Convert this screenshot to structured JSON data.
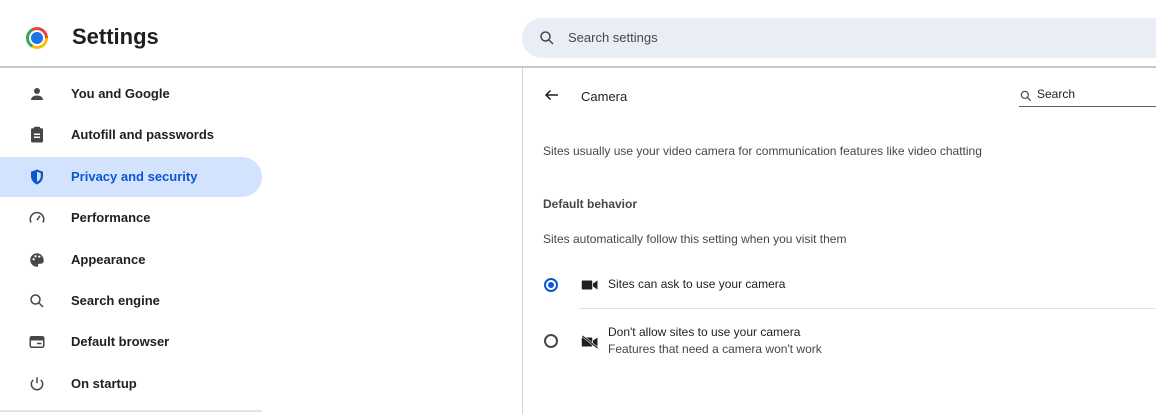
{
  "header": {
    "app_title": "Settings",
    "search_placeholder": "Search settings"
  },
  "sidebar": {
    "items": [
      {
        "label": "You and Google",
        "icon": "person-icon",
        "active": false
      },
      {
        "label": "Autofill and passwords",
        "icon": "clipboard-icon",
        "active": false
      },
      {
        "label": "Privacy and security",
        "icon": "shield-icon",
        "active": true
      },
      {
        "label": "Performance",
        "icon": "speedometer-icon",
        "active": false
      },
      {
        "label": "Appearance",
        "icon": "palette-icon",
        "active": false
      },
      {
        "label": "Search engine",
        "icon": "search-icon",
        "active": false
      },
      {
        "label": "Default browser",
        "icon": "browser-window-icon",
        "active": false
      },
      {
        "label": "On startup",
        "icon": "power-icon",
        "active": false
      }
    ]
  },
  "main": {
    "title": "Camera",
    "search_placeholder": "Search",
    "description": "Sites usually use your video camera for communication features like video chatting",
    "default_behavior_heading": "Default behavior",
    "default_behavior_sub": "Sites automatically follow this setting when you visit them",
    "options": [
      {
        "label": "Sites can ask to use your camera",
        "sub": "",
        "selected": true,
        "icon": "camera-icon"
      },
      {
        "label": "Don't allow sites to use your camera",
        "sub": "Features that need a camera won't work",
        "selected": false,
        "icon": "camera-off-icon"
      }
    ]
  },
  "colors": {
    "accent": "#0b57d0",
    "active_nav_bg": "#d3e3fd",
    "search_bg": "#e9eef6"
  }
}
